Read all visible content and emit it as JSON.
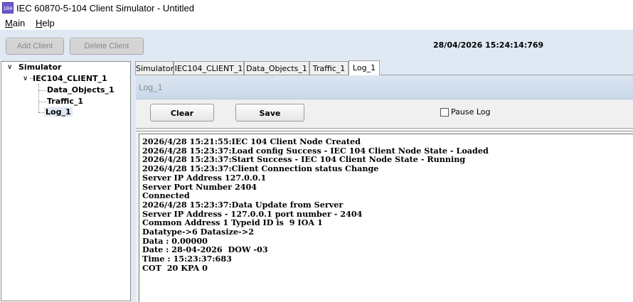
{
  "window": {
    "icon_text": "104",
    "title": "IEC 60870-5-104 Client Simulator - Untitled"
  },
  "menu": {
    "main_ul": "M",
    "main_rest": "ain",
    "help_ul": "H",
    "help_rest": "elp"
  },
  "toolbar": {
    "add_client": "Add Client",
    "delete_client": "Delete Client",
    "datetime": "28/04/2026 15:24:14:769"
  },
  "tree": {
    "root": "Simulator",
    "client": "IEC104_CLIENT_1",
    "children": [
      "Data_Objects_1",
      "Traffic_1",
      "Log_1"
    ],
    "selected": "Log_1"
  },
  "tabs": [
    "Simulator",
    "IEC104_CLIENT_1",
    "Data_Objects_1",
    "Traffic_1",
    "Log_1"
  ],
  "active_tab": "Log_1",
  "panel": {
    "title": "Log_1",
    "clear_label": "Clear",
    "save_label": "Save",
    "pause_label": "Pause Log",
    "pause_checked": false
  },
  "log": [
    "2026/4/28 15:21:55:IEC 104 Client Node Created",
    "2026/4/28 15:23:37:Load config Success - IEC 104 Client Node State - Loaded",
    "2026/4/28 15:23:37:Start Success - IEC 104 Client Node State - Running",
    "2026/4/28 15:23:37:Client Connection status Change",
    "Server IP Address 127.0.0.1",
    "Server Port Number 2404",
    "Connected",
    "2026/4/28 15:23:37:Data Update from Server",
    "Server IP Address - 127.0.0.1 port number - 2404",
    "Common Address 1 Typeid ID is  9 IOA 1",
    "Datatype->6 Datasize->2",
    "Data : 0.00000",
    "Date : 28-04-2026  DOW -03",
    "Time : 15:23:37:683",
    "COT  20 KPA 0"
  ]
}
